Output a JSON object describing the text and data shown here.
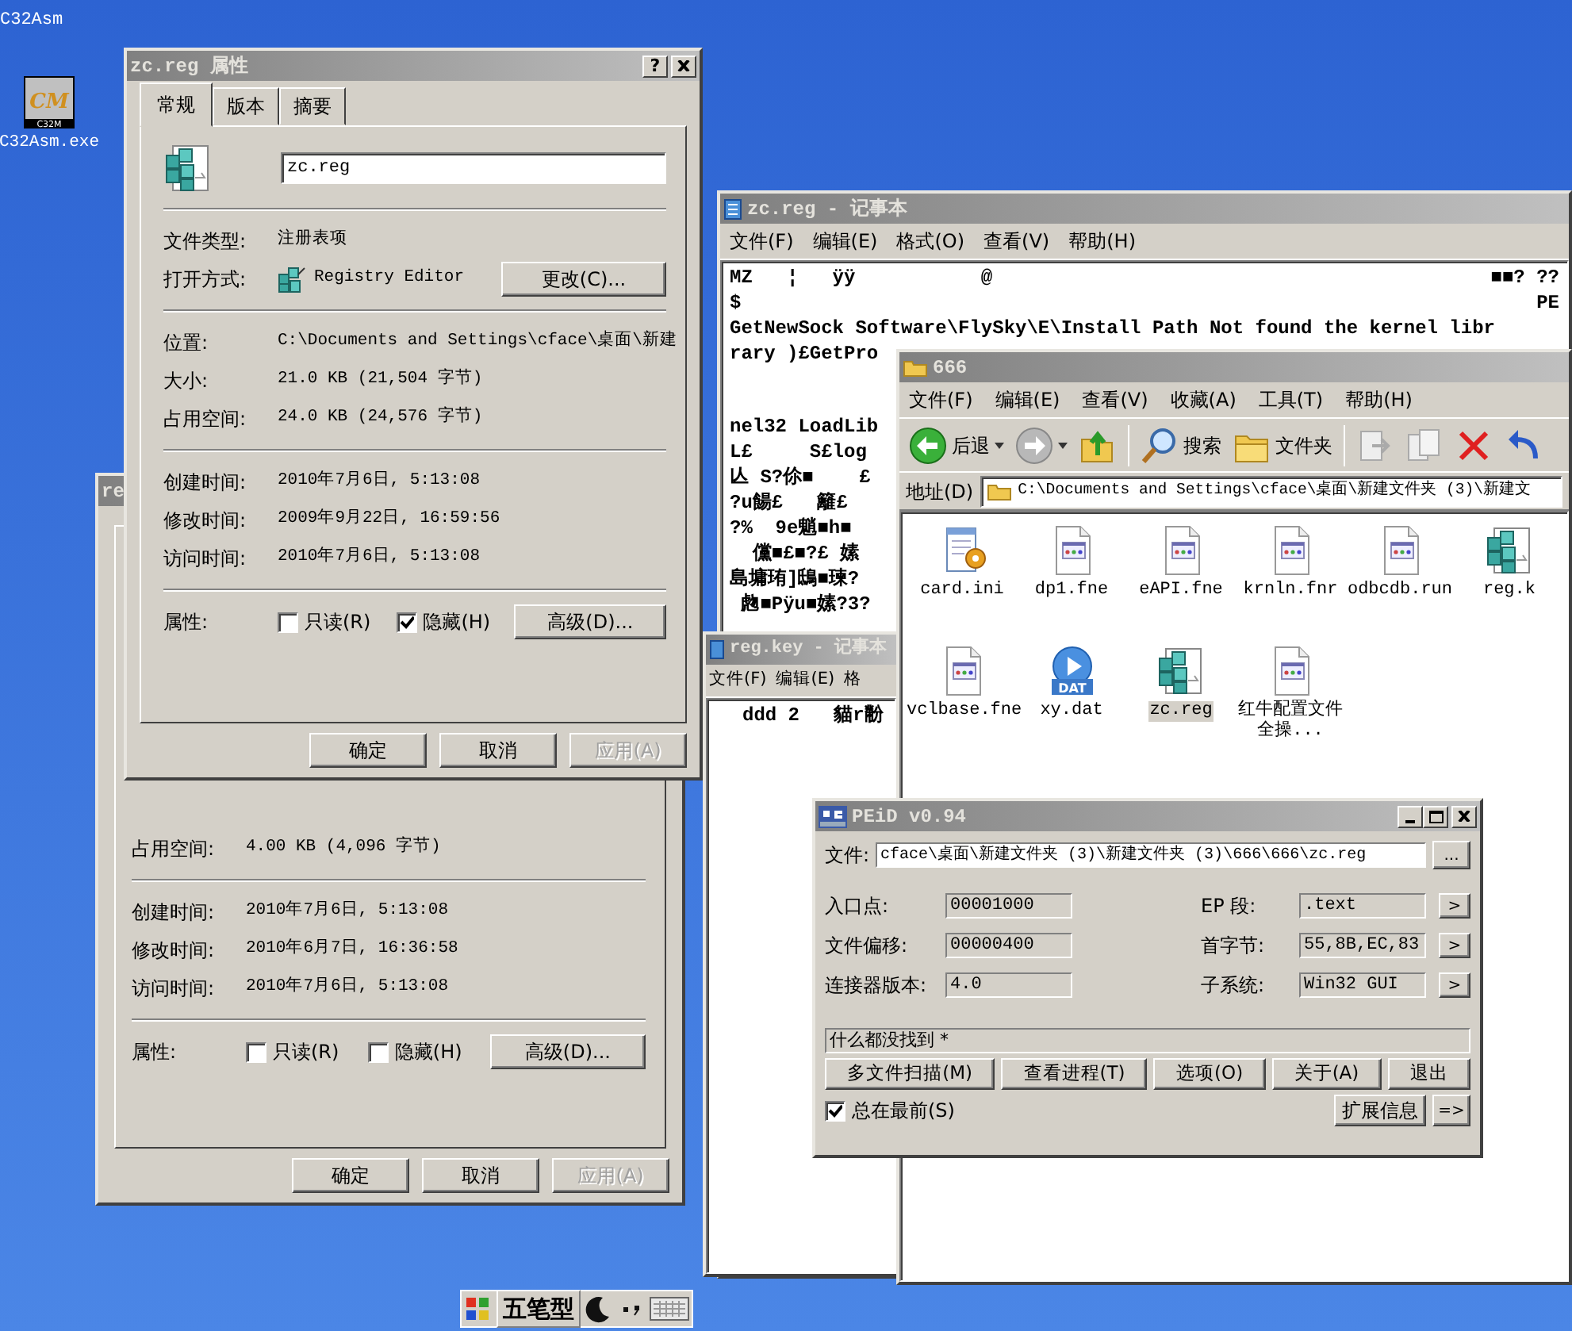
{
  "desktop": {
    "corner_label": "C32Asm",
    "icons": [
      {
        "label": "C32Asm.exe",
        "logo": "CM",
        "caption": "C32M"
      }
    ]
  },
  "properties_back": {
    "title": "re",
    "groups": [
      [
        {
          "label": "占用空间:",
          "value": "4.00 KB (4,096 字节)",
          "kind": "text"
        }
      ],
      [
        {
          "label": "创建时间:",
          "value": "2010年7月6日, 5:13:08",
          "kind": "text"
        },
        {
          "label": "修改时间:",
          "value": "2010年6月7日, 16:36:58",
          "kind": "text"
        },
        {
          "label": "访问时间:",
          "value": "2010年7月6日, 5:13:08",
          "kind": "text"
        }
      ]
    ],
    "attributes_label": "属性:",
    "attributes": [
      {
        "label": "只读(R)",
        "checked": false
      },
      {
        "label": "隐藏(H)",
        "checked": false
      }
    ],
    "advanced_button": "高级(D)...",
    "buttons": [
      {
        "label": "确定",
        "disabled": false
      },
      {
        "label": "取消",
        "disabled": false
      },
      {
        "label": "应用(A)",
        "disabled": true
      }
    ]
  },
  "notepad": {
    "title": "zc.reg - 记事本",
    "menu": [
      "文件(F)",
      "编辑(E)",
      "格式(O)",
      "查看(V)",
      "帮助(H)"
    ],
    "lines_top": [
      {
        "text": "MZ   ¦   ÿÿ           @",
        "end": "■■? ??"
      },
      {
        "text": "$",
        "end": "PE"
      },
      {
        "text": "GetNewSock Software\\FlySky\\E\\Install Path Not found the kernel libr"
      },
      {
        "text": "rary )£GetPro"
      }
    ],
    "lines_bottom": [
      "nel32 LoadLib",
      "L£     S£log",
      "亾 S?伱■    £",
      "?u餳£   籬£",
      "?%  9e魈■h■",
      "  儻■£■?£ 嫊",
      "島墉珛]鴟■瑓?",
      " 虝■Pÿu■嫊?3?"
    ]
  },
  "reg_key_notepad": {
    "title": "reg.key - 记事本",
    "menu": [
      "文件(F)",
      "编辑(E)",
      "格"
    ],
    "lines": [
      "ddd 2   貓r黺"
    ]
  },
  "explorer": {
    "title": "666",
    "menu": [
      "文件(F)",
      "编辑(E)",
      "查看(V)",
      "收藏(A)",
      "工具(T)",
      "帮助(H)"
    ],
    "toolbar": [
      {
        "kind": "back",
        "label": "后退"
      },
      {
        "kind": "forward"
      },
      {
        "kind": "up"
      },
      {
        "kind": "search",
        "label": "搜索"
      },
      {
        "kind": "folders",
        "label": "文件夹"
      },
      {
        "kind": "move"
      },
      {
        "kind": "copy"
      },
      {
        "kind": "delete"
      },
      {
        "kind": "undo"
      }
    ],
    "address_label": "地址(D)",
    "address": "C:\\Documents and Settings\\cface\\桌面\\新建文件夹 (3)\\新建文",
    "files": [
      {
        "name": "card.ini",
        "kind": "ini",
        "selected": false
      },
      {
        "name": "dp1.fne",
        "kind": "doc",
        "selected": false
      },
      {
        "name": "eAPI.fne",
        "kind": "doc",
        "selected": false
      },
      {
        "name": "krnln.fnr",
        "kind": "doc",
        "selected": false
      },
      {
        "name": "odbcdb.run",
        "kind": "doc",
        "selected": false
      },
      {
        "name": "reg.k",
        "kind": "reg",
        "selected": false
      },
      {
        "name": "vclbase.fne",
        "kind": "doc",
        "selected": false
      },
      {
        "name": "xy.dat",
        "kind": "dat",
        "badge": "DAT",
        "selected": false
      },
      {
        "name": "zc.reg",
        "kind": "reg",
        "selected": true
      },
      {
        "name": "红牛配置文件全操...",
        "kind": "doc",
        "selected": false
      }
    ]
  },
  "peid": {
    "title": "PEiD v0.94",
    "file_label": "文件:",
    "file_path": "cface\\桌面\\新建文件夹 (3)\\新建文件夹 (3)\\666\\666\\zc.reg",
    "browse_button": "...",
    "fields": [
      {
        "label": "入口点:",
        "value": "00001000",
        "label_2": "EP 段:",
        "value_2": ".text",
        "button": ">"
      },
      {
        "label": "文件偏移:",
        "value": "00000400",
        "label_2": "首字节:",
        "value_2": "55,8B,EC,83",
        "button": ">"
      },
      {
        "label": "连接器版本:",
        "value": "4.0",
        "label_2": "子系统:",
        "value_2": "Win32 GUI",
        "button": ">"
      }
    ],
    "status": "什么都没找到  *",
    "buttons": [
      "多文件扫描(M)",
      "查看进程(T)",
      "选项(O)",
      "关于(A)",
      "退出"
    ],
    "stay_on_top": {
      "label": "总在最前(S)",
      "checked": true
    },
    "ext_button": "扩展信息",
    "arrow_button": "=>"
  },
  "properties_front": {
    "title": "zc.reg 属性",
    "help_button": "?",
    "tabs": [
      {
        "label": "常规",
        "selected": true
      },
      {
        "label": "版本",
        "selected": false
      },
      {
        "label": "摘要",
        "selected": false
      }
    ],
    "file_name": "zc.reg",
    "groups": [
      [
        {
          "label": "文件类型:",
          "value": "注册表项",
          "kind": "text"
        },
        {
          "label": "打开方式:",
          "value": "Registry Editor",
          "kind": "open_with",
          "button": "更改(C)..."
        }
      ],
      [
        {
          "label": "位置:",
          "value": "C:\\Documents and Settings\\cface\\桌面\\新建",
          "kind": "text"
        },
        {
          "label": "大小:",
          "value": "21.0 KB (21,504 字节)",
          "kind": "text"
        },
        {
          "label": "占用空间:",
          "value": "24.0 KB (24,576 字节)",
          "kind": "text"
        }
      ],
      [
        {
          "label": "创建时间:",
          "value": "2010年7月6日, 5:13:08",
          "kind": "text"
        },
        {
          "label": "修改时间:",
          "value": "2009年9月22日, 16:59:56",
          "kind": "text"
        },
        {
          "label": "访问时间:",
          "value": "2010年7月6日, 5:13:08",
          "kind": "text"
        }
      ]
    ],
    "attributes_label": "属性:",
    "attributes": [
      {
        "label": "只读(R)",
        "checked": false
      },
      {
        "label": "隐藏(H)",
        "checked": true
      }
    ],
    "advanced_button": "高级(D)...",
    "buttons": [
      {
        "label": "确定",
        "disabled": false
      },
      {
        "label": "取消",
        "disabled": false
      },
      {
        "label": "应用(A)",
        "disabled": true
      }
    ]
  },
  "ime_bar": {
    "mode": "五笔型"
  }
}
